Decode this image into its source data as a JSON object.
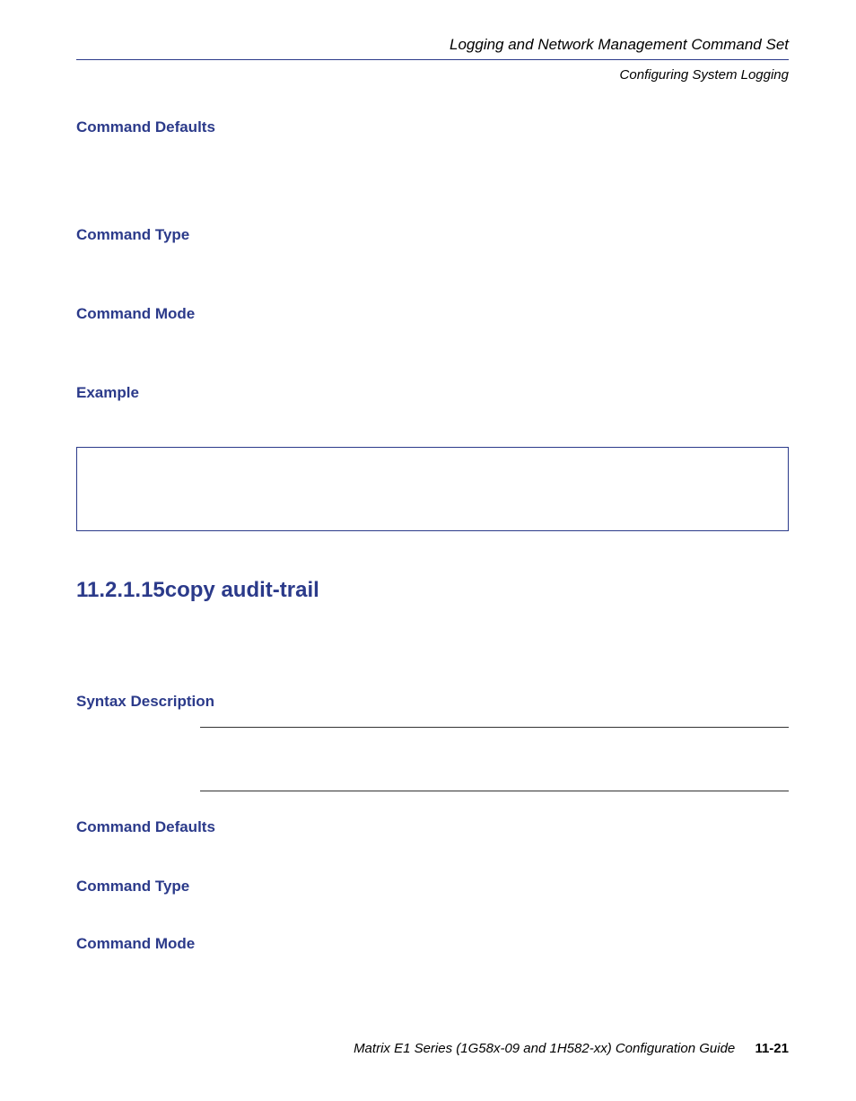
{
  "header": {
    "title": "Logging and Network Management Command Set",
    "subtitle": "Configuring System Logging"
  },
  "sections": {
    "command_defaults_1": "Command Defaults",
    "command_type_1": "Command Type",
    "command_mode_1": "Command Mode",
    "example": "Example",
    "command_title": "11.2.1.15copy audit-trail",
    "syntax_description": "Syntax Description",
    "command_defaults_2": "Command Defaults",
    "command_type_2": "Command Type",
    "command_mode_2": "Command Mode"
  },
  "footer": {
    "text": "Matrix E1 Series (1G58x-09 and 1H582-xx) Configuration Guide",
    "page": "11-21"
  }
}
